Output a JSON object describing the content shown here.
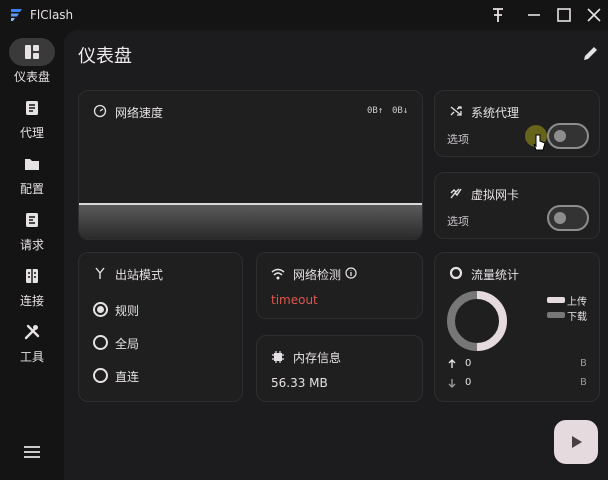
{
  "window": {
    "title": "FlClash",
    "controls": [
      "pin-icon",
      "minimize-icon",
      "maximize-icon",
      "close-icon"
    ]
  },
  "nav": {
    "items": [
      {
        "label": "仪表盘",
        "icon": "dashboard-icon",
        "active": true
      },
      {
        "label": "代理",
        "icon": "proxy-icon",
        "active": false
      },
      {
        "label": "配置",
        "icon": "folder-icon",
        "active": false
      },
      {
        "label": "请求",
        "icon": "requests-icon",
        "active": false
      },
      {
        "label": "连接",
        "icon": "connections-icon",
        "active": false
      },
      {
        "label": "工具",
        "icon": "tools-icon",
        "active": false
      }
    ],
    "menu_icon": "menu-icon"
  },
  "page": {
    "title": "仪表盘",
    "edit_icon": "edit-icon"
  },
  "network_speed": {
    "title": "网络速度",
    "upload": "0B↑",
    "download": "0B↓"
  },
  "system_proxy": {
    "title": "系统代理",
    "options_label": "选项",
    "enabled": false
  },
  "tun": {
    "title": "虚拟网卡",
    "options_label": "选项",
    "enabled": false
  },
  "outbound_mode": {
    "title": "出站模式",
    "options": [
      {
        "label": "规则",
        "selected": true
      },
      {
        "label": "全局",
        "selected": false
      },
      {
        "label": "直连",
        "selected": false
      }
    ]
  },
  "network_check": {
    "title": "网络检测",
    "result": "timeout"
  },
  "memory": {
    "title": "内存信息",
    "value": "56.33  MB"
  },
  "traffic": {
    "title": "流量统计",
    "legend_upload": "上传",
    "legend_download": "下载",
    "upload_value": "0",
    "upload_unit": "B",
    "download_value": "0",
    "download_unit": "B"
  },
  "colors": {
    "accent": "#e5dade",
    "error": "#e0574f",
    "upload_series": "#e5dade",
    "download_series": "#777777"
  }
}
